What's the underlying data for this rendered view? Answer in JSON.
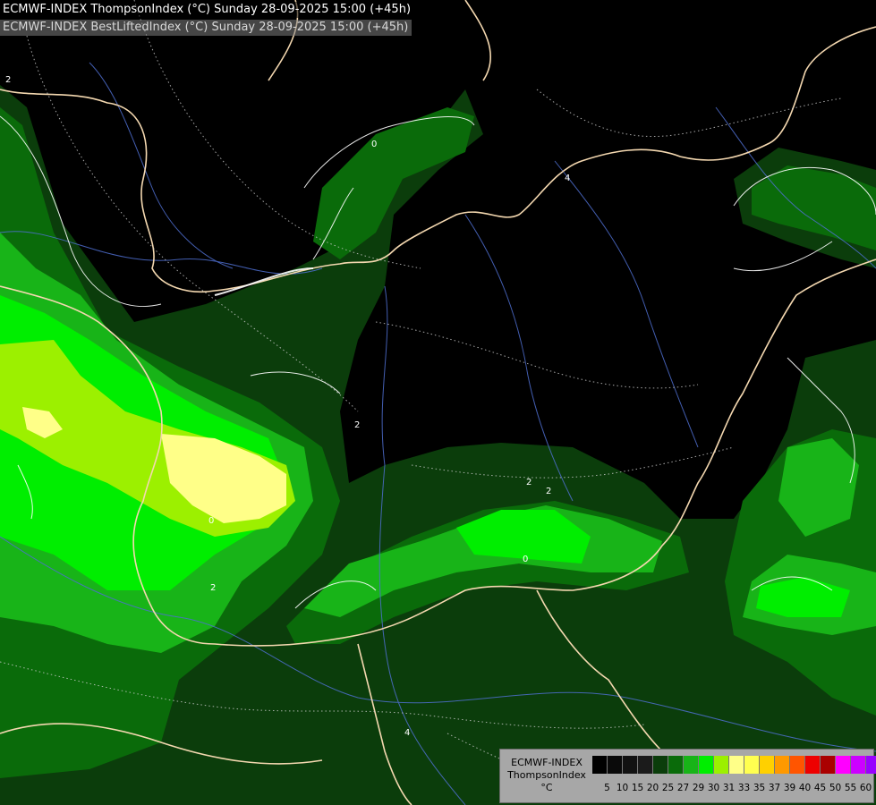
{
  "header": {
    "line1": "ECMWF-INDEX ThompsonIndex (°C) Sunday 28-09-2025 15:00 (+45h)",
    "line2": "ECMWF-INDEX BestLiftedIndex (°C) Sunday 28-09-2025 15:00 (+45h)"
  },
  "legend": {
    "title1": "ECMWF-INDEX",
    "title2": "ThompsonIndex",
    "unit": "°C",
    "colors": [
      "#000000",
      "#0a0a0a",
      "#121212",
      "#1b1b1b",
      "#0b3d0b",
      "#0a6b0a",
      "#18b418",
      "#00ee00",
      "#9cf000",
      "#ffff88",
      "#ffff50",
      "#ffd000",
      "#ff9900",
      "#ff5500",
      "#ee0000",
      "#aa0000",
      "#ff00ff",
      "#cc00ff",
      "#9900ff",
      "#6600ff",
      "#0000ff"
    ],
    "ticks": [
      "5",
      "10",
      "15",
      "20",
      "25",
      "27",
      "29",
      "30",
      "31",
      "33",
      "35",
      "37",
      "39",
      "40",
      "45",
      "50",
      "55",
      "60"
    ]
  },
  "contour_labels": [
    "2",
    "0",
    "2",
    "0",
    "2",
    "2",
    "0",
    "4",
    "4",
    "2"
  ]
}
